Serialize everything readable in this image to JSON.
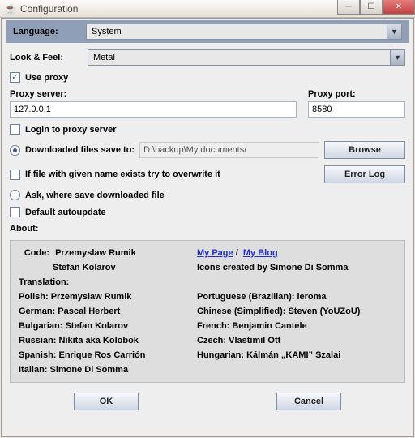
{
  "window": {
    "title": "Configuration"
  },
  "language": {
    "label": "Language:",
    "value": "System"
  },
  "lookfeel": {
    "label": "Look & Feel:",
    "value": "Metal"
  },
  "use_proxy": {
    "label": "Use proxy",
    "checked": true
  },
  "proxy_server": {
    "label": "Proxy server:",
    "value": "127.0.0.1"
  },
  "proxy_port": {
    "label": "Proxy port:",
    "value": "8580"
  },
  "login_proxy": {
    "label": "Login to proxy server",
    "checked": false
  },
  "saveto": {
    "label": "Downloaded files save to:",
    "value": "D:\\backup\\My documents/",
    "selected": true
  },
  "browse": "Browse",
  "overwrite": {
    "label": "If file with given name exists try to overwrite it",
    "checked": false
  },
  "errorlog": "Error Log",
  "ask_save": {
    "label": "Ask, where save downloaded file",
    "selected": false
  },
  "autoupdate": {
    "label": "Default autoupdate",
    "checked": false
  },
  "about_label": "About:",
  "about": {
    "code_label": "Code:",
    "code1": "Przemyslaw Rumik",
    "code2": "Stefan Kolarov",
    "my_page": "My Page",
    "my_blog": "My Blog",
    "icons": "Icons created by Simone Di Somma",
    "translation_label": "Translation:",
    "polish": "Polish: Przemyslaw Rumik",
    "german": "German: Pascal Herbert",
    "bulgarian": "Bulgarian: Stefan Kolarov",
    "russian": "Russian: Nikita aka Kolobok",
    "spanish": "Spanish: Enrique Ros Carrión",
    "italian": "Italian: Simone Di Somma",
    "portuguese": "Portuguese (Brazilian): leroma",
    "chinese": "Chinese (Simplified): Steven (YoUZoU)",
    "french": "French: Benjamin Cantele",
    "czech": "Czech: Vlastimil Ott",
    "hungarian": "Hungarian: Kálmán „KAMI”  Szalai",
    "sep": "/"
  },
  "ok": "OK",
  "cancel": "Cancel"
}
